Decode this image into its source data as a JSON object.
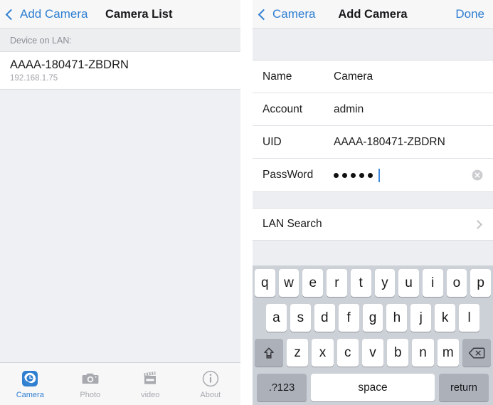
{
  "colors": {
    "accent_blue": "#2f7fd1",
    "nav_bg": "#f7f7f8",
    "list_bg": "#eff0f3",
    "keyboard_bg": "#ccd0d7",
    "key_white": "#ffffff",
    "key_gray": "#abb0b9",
    "text_primary": "#1c1c1e",
    "text_muted": "#a2a4a9"
  },
  "left_screen": {
    "navbar": {
      "back_label": "Add Camera",
      "back_icon": "chevron-left-icon",
      "title": "Camera List"
    },
    "section_header": "Device on LAN:",
    "devices": [
      {
        "uid": "AAAA-180471-ZBDRN",
        "ip": "192.168.1.75"
      }
    ],
    "tabbar": {
      "items": [
        {
          "label": "Camera",
          "icon": "camera-app-icon",
          "active": true
        },
        {
          "label": "Photo",
          "icon": "photo-camera-icon",
          "active": false
        },
        {
          "label": "video",
          "icon": "clapperboard-icon",
          "active": false
        },
        {
          "label": "About",
          "icon": "info-circle-icon",
          "active": false
        }
      ]
    }
  },
  "right_screen": {
    "navbar": {
      "back_label": "Camera",
      "back_icon": "chevron-left-icon",
      "title": "Add Camera",
      "done_label": "Done"
    },
    "form": {
      "rows": [
        {
          "label": "Name",
          "value": "Camera",
          "type": "text"
        },
        {
          "label": "Account",
          "value": "admin",
          "type": "text"
        },
        {
          "label": "UID",
          "value": "AAAA-180471-ZBDRN",
          "type": "text"
        },
        {
          "label": "PassWord",
          "value": "•••••",
          "type": "password",
          "dots": 5,
          "focused": true,
          "clear_icon": "clear-circle-icon"
        }
      ]
    },
    "lan_search": {
      "label": "LAN Search",
      "disclosure_icon": "chevron-right-icon"
    },
    "keyboard": {
      "row1": [
        "q",
        "w",
        "e",
        "r",
        "t",
        "y",
        "u",
        "i",
        "o",
        "p"
      ],
      "row2": [
        "a",
        "s",
        "d",
        "f",
        "g",
        "h",
        "j",
        "k",
        "l"
      ],
      "row3": [
        "z",
        "x",
        "c",
        "v",
        "b",
        "n",
        "m"
      ],
      "shift_icon": "shift-arrow-icon",
      "backspace_icon": "backspace-icon",
      "numbers_label": ".?123",
      "space_label": "space",
      "return_label": "return"
    }
  }
}
